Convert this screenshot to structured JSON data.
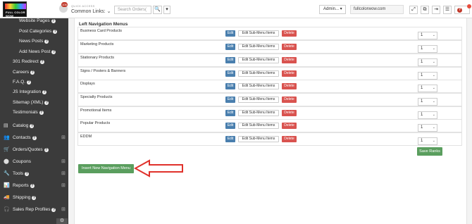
{
  "header": {
    "logo_text": "FULL COLOR WOW",
    "notification_count": "106",
    "quick_access_label": "QUICK ACCESS",
    "common_links_label": "Common Links: ⌄",
    "search_placeholder": "Search Orders(",
    "search_icon": "🔍",
    "search_caret": "▾",
    "admin_label": "Admin... ▾",
    "site_name": "fullcolorwow.com",
    "icons": [
      "expand-icon",
      "external-link-icon",
      "logout-icon",
      "menu-icon",
      "help-icon"
    ],
    "icon_glyphs": [
      "⤢",
      "⧉",
      "⇥",
      "☰"
    ],
    "help_glyph": "?"
  },
  "sidebar": {
    "items": [
      {
        "label": "Website Pages",
        "help": "?"
      },
      {
        "label": "Post Categories",
        "help": "?"
      },
      {
        "label": "News Posts",
        "help": "?"
      },
      {
        "label": "Add News Post",
        "help": "?"
      },
      {
        "label": "301 Redirect",
        "help": "?"
      },
      {
        "label": "Careers",
        "help": "?"
      },
      {
        "label": "F.A.Q.",
        "help": "?"
      },
      {
        "label": "JS Integration",
        "help": "?"
      },
      {
        "label": "Sitemap (XML)",
        "help": "?"
      },
      {
        "label": "Testimonials",
        "help": "?"
      }
    ],
    "sections": [
      {
        "label": "Catalog",
        "help": "?",
        "icon": "▤",
        "plus": ""
      },
      {
        "label": "Contacts",
        "help": "?",
        "icon": "👥",
        "plus": "⊞"
      },
      {
        "label": "Orders/Quotes",
        "help": "?",
        "icon": "🛒",
        "plus": ""
      },
      {
        "label": "Coupons",
        "help": "",
        "icon": "⬤",
        "plus": "⊞"
      },
      {
        "label": "Tools",
        "help": "?",
        "icon": "🔧",
        "plus": "⊞"
      },
      {
        "label": "Reports",
        "help": "?",
        "icon": "📊",
        "plus": "⊞"
      },
      {
        "label": "Shipping",
        "help": "?",
        "icon": "🚚",
        "plus": ""
      },
      {
        "label": "Sales Rep Profiles",
        "help": "?",
        "icon": "🎧",
        "plus": "⊞"
      }
    ],
    "settings_glyph": "⚙"
  },
  "main": {
    "title": "Left Navigation Menus",
    "edit_label": "Edit",
    "sub_label": "Edit Sub-Menu Items",
    "delete_label": "Delete",
    "rank_caret": "⌄",
    "menus": [
      {
        "name": "Business Card Products",
        "rank": "1"
      },
      {
        "name": "Marketing Products",
        "rank": "1"
      },
      {
        "name": "Stationary Products",
        "rank": "1"
      },
      {
        "name": "Signs / Posters & Banners",
        "rank": "1"
      },
      {
        "name": "Displays",
        "rank": "1"
      },
      {
        "name": "Specialty Products",
        "rank": "1"
      },
      {
        "name": "Promotional Items",
        "rank": "1"
      },
      {
        "name": "Popular Products",
        "rank": "1"
      },
      {
        "name": "EDDM",
        "rank": "1"
      }
    ],
    "save_label": "Save Ranks",
    "insert_label": "Insert New Navigation Menu",
    "arrow_color": "#e0312b"
  }
}
